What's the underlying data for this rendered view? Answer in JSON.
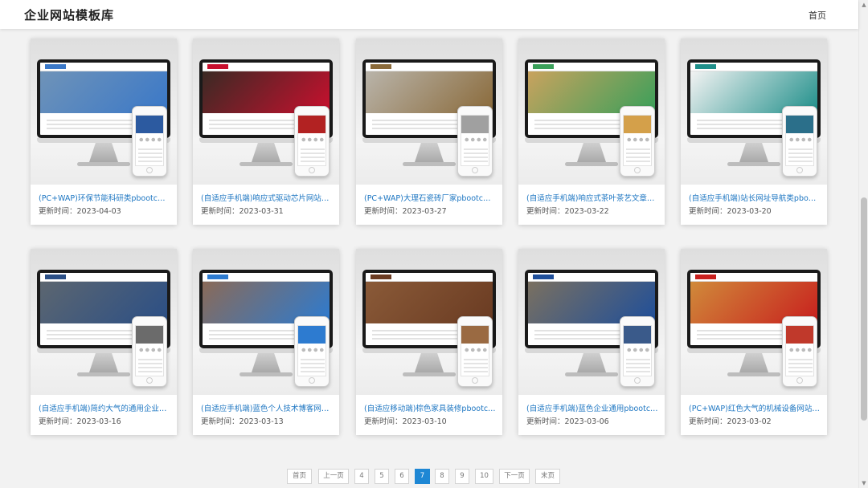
{
  "header": {
    "site_title": "企业网站模板库",
    "nav_home": "首页"
  },
  "cards": [
    {
      "title": "(PC+WAP)环保节能科研类pbootcms网...",
      "date_label": "更新时间：",
      "date": "2023-04-03",
      "theme": "#3a78c8",
      "hero": "#6f93b8",
      "phone_hero": "#2c5aa0"
    },
    {
      "title": "(自适应手机端)响应式驱动芯片网站pboot...",
      "date_label": "更新时间：",
      "date": "2023-03-31",
      "theme": "#c8102e",
      "hero": "#3a2a24",
      "phone_hero": "#b22222"
    },
    {
      "title": "(PC+WAP)大理石瓷砖厂家pbootcms网...",
      "date_label": "更新时间：",
      "date": "2023-03-27",
      "theme": "#8a6a3a",
      "hero": "#b9b4aa",
      "phone_hero": "#a0a0a0"
    },
    {
      "title": "(自适应手机端)响应式茶叶茶艺文章类网...",
      "date_label": "更新时间：",
      "date": "2023-03-22",
      "theme": "#3aa05a",
      "hero": "#c9a25e",
      "phone_hero": "#d4a04a"
    },
    {
      "title": "(自适应手机端)站长网址导航类pbootcms...",
      "date_label": "更新时间：",
      "date": "2023-03-20",
      "theme": "#1f8f8a",
      "hero": "#f3f3f3",
      "phone_hero": "#2b6f8a"
    },
    {
      "title": "(自适应手机端)简约大气的通用企业网站p...",
      "date_label": "更新时间：",
      "date": "2023-03-16",
      "theme": "#2b4f86",
      "hero": "#5c6670",
      "phone_hero": "#6b6b6b"
    },
    {
      "title": "(自适应手机端)蓝色个人技术博客网站pbo...",
      "date_label": "更新时间：",
      "date": "2023-03-13",
      "theme": "#2d7bd0",
      "hero": "#8a6a58",
      "phone_hero": "#2d7bd0"
    },
    {
      "title": "(自适应移动端)棕色家具装修pbootcms网...",
      "date_label": "更新时间：",
      "date": "2023-03-10",
      "theme": "#6a3b22",
      "hero": "#8a5a38",
      "phone_hero": "#9a6a42"
    },
    {
      "title": "(自适应手机端)蓝色企业通用pbootcms网...",
      "date_label": "更新时间：",
      "date": "2023-03-06",
      "theme": "#1f4f9a",
      "hero": "#7a7060",
      "phone_hero": "#3a5a8a"
    },
    {
      "title": "(PC+WAP)红色大气的机械设备网站pboo...",
      "date_label": "更新时间：",
      "date": "2023-03-02",
      "theme": "#c8201e",
      "hero": "#d08a3a",
      "phone_hero": "#c0392b"
    }
  ],
  "pagination": {
    "first": "首页",
    "prev": "上一页",
    "pages": [
      "4",
      "5",
      "6",
      "7",
      "8",
      "9",
      "10"
    ],
    "current": "7",
    "next": "下一页",
    "last": "末页"
  },
  "colors": {
    "link": "#1d76c2",
    "active_page": "#1e87d4"
  }
}
